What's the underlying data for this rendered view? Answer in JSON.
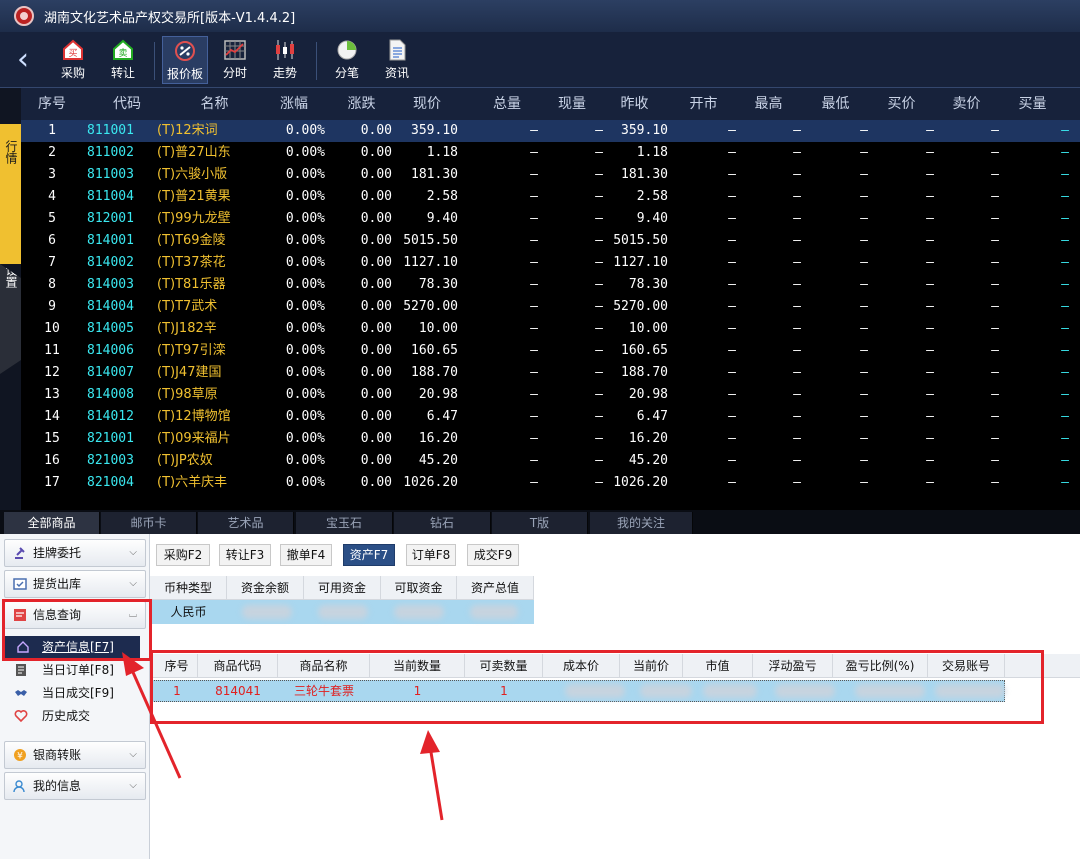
{
  "window": {
    "title": "湖南文化艺术品产权交易所[版本-V1.4.4.2]"
  },
  "toolbar": {
    "buttons": [
      {
        "label": "采购",
        "icon": "purchase-icon"
      },
      {
        "label": "转让",
        "icon": "transfer-icon"
      },
      {
        "label": "报价板",
        "icon": "quote-board-icon"
      },
      {
        "label": "分时",
        "icon": "timeshare-icon"
      },
      {
        "label": "走势",
        "icon": "candlestick-icon"
      },
      {
        "label": "分笔",
        "icon": "tick-pie-icon"
      },
      {
        "label": "资讯",
        "icon": "news-icon"
      }
    ]
  },
  "side_tabs": {
    "quote": "行情",
    "settings": "设置"
  },
  "quote_table": {
    "headers": [
      "序号",
      "代码",
      "名称",
      "涨幅",
      "涨跌",
      "现价",
      "总量",
      "现量",
      "昨收",
      "开市",
      "最高",
      "最低",
      "买价",
      "卖价",
      "买量"
    ],
    "dash": "—",
    "rows": [
      {
        "no": "1",
        "code": "811001",
        "name": "(T)12宋词",
        "pct": "0.00%",
        "chg": "0.00",
        "price": "359.10",
        "prev": "359.10"
      },
      {
        "no": "2",
        "code": "811002",
        "name": "(T)普27山东",
        "pct": "0.00%",
        "chg": "0.00",
        "price": "1.18",
        "prev": "1.18"
      },
      {
        "no": "3",
        "code": "811003",
        "name": "(T)六骏小版",
        "pct": "0.00%",
        "chg": "0.00",
        "price": "181.30",
        "prev": "181.30"
      },
      {
        "no": "4",
        "code": "811004",
        "name": "(T)普21黄果",
        "pct": "0.00%",
        "chg": "0.00",
        "price": "2.58",
        "prev": "2.58"
      },
      {
        "no": "5",
        "code": "812001",
        "name": "(T)99九龙壁",
        "pct": "0.00%",
        "chg": "0.00",
        "price": "9.40",
        "prev": "9.40"
      },
      {
        "no": "6",
        "code": "814001",
        "name": "(T)T69金陵",
        "pct": "0.00%",
        "chg": "0.00",
        "price": "5015.50",
        "prev": "5015.50"
      },
      {
        "no": "7",
        "code": "814002",
        "name": "(T)T37茶花",
        "pct": "0.00%",
        "chg": "0.00",
        "price": "1127.10",
        "prev": "1127.10"
      },
      {
        "no": "8",
        "code": "814003",
        "name": "(T)T81乐器",
        "pct": "0.00%",
        "chg": "0.00",
        "price": "78.30",
        "prev": "78.30"
      },
      {
        "no": "9",
        "code": "814004",
        "name": "(T)T7武术",
        "pct": "0.00%",
        "chg": "0.00",
        "price": "5270.00",
        "prev": "5270.00"
      },
      {
        "no": "10",
        "code": "814005",
        "name": "(T)J182辛",
        "pct": "0.00%",
        "chg": "0.00",
        "price": "10.00",
        "prev": "10.00"
      },
      {
        "no": "11",
        "code": "814006",
        "name": "(T)T97引滦",
        "pct": "0.00%",
        "chg": "0.00",
        "price": "160.65",
        "prev": "160.65"
      },
      {
        "no": "12",
        "code": "814007",
        "name": "(T)J47建国",
        "pct": "0.00%",
        "chg": "0.00",
        "price": "188.70",
        "prev": "188.70"
      },
      {
        "no": "13",
        "code": "814008",
        "name": "(T)98草原",
        "pct": "0.00%",
        "chg": "0.00",
        "price": "20.98",
        "prev": "20.98"
      },
      {
        "no": "14",
        "code": "814012",
        "name": "(T)12博物馆",
        "pct": "0.00%",
        "chg": "0.00",
        "price": "6.47",
        "prev": "6.47"
      },
      {
        "no": "15",
        "code": "821001",
        "name": "(T)09来福片",
        "pct": "0.00%",
        "chg": "0.00",
        "price": "16.20",
        "prev": "16.20"
      },
      {
        "no": "16",
        "code": "821003",
        "name": "(T)JP农奴",
        "pct": "0.00%",
        "chg": "0.00",
        "price": "45.20",
        "prev": "45.20"
      },
      {
        "no": "17",
        "code": "821004",
        "name": "(T)六羊庆丰",
        "pct": "0.00%",
        "chg": "0.00",
        "price": "1026.20",
        "prev": "1026.20"
      }
    ]
  },
  "category_tabs": [
    "全部商品",
    "邮币卡",
    "艺术品",
    "宝玉石",
    "钻石",
    "T版",
    "我的关注"
  ],
  "left_nav": {
    "groups": [
      "挂牌委托",
      "提货出库",
      "信息查询",
      "银商转账",
      "我的信息"
    ],
    "sub_items": [
      "资产信息[F7]",
      "当日订单[F8]",
      "当日成交[F9]",
      "历史成交"
    ]
  },
  "func_buttons": [
    "采购F2",
    "转让F3",
    "撤单F4",
    "资产F7",
    "订单F8",
    "成交F9"
  ],
  "asset_table": {
    "headers": [
      "币种类型",
      "资金余额",
      "可用资金",
      "可取资金",
      "资产总值"
    ],
    "currency": "人民币"
  },
  "holdings_table": {
    "headers": [
      "序号",
      "商品代码",
      "商品名称",
      "当前数量",
      "可卖数量",
      "成本价",
      "当前价",
      "市值",
      "浮动盈亏",
      "盈亏比例(%)",
      "交易账号"
    ],
    "row": {
      "no": "1",
      "code": "814041",
      "name": "三轮牛套票",
      "qty": "1",
      "sellable": "1"
    }
  },
  "colors": {
    "quote_bg": "#000000",
    "code_cyan": "#3ae8f0",
    "name_gold": "#f0c030",
    "annotation_red": "#e3242b",
    "active_nav": "#1d2b4f"
  }
}
